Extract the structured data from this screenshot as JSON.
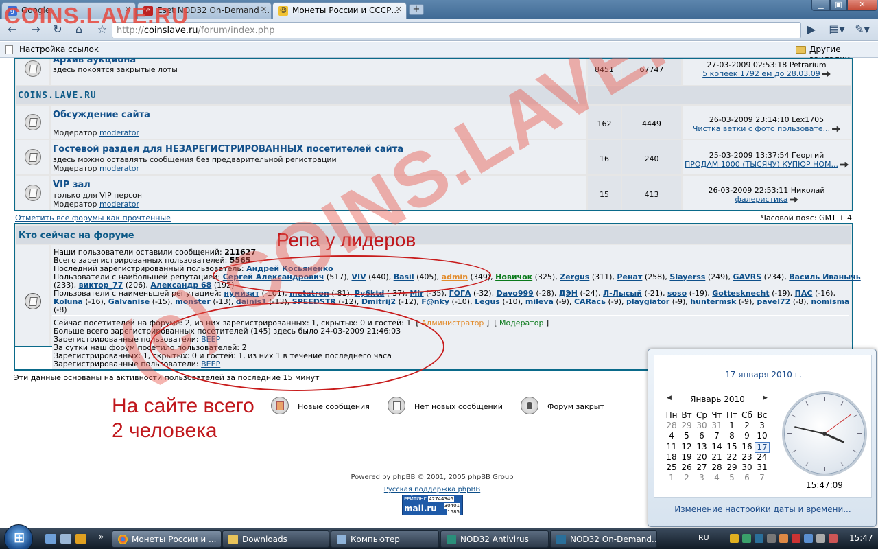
{
  "browser": {
    "tabs": [
      {
        "label": "Google"
      },
      {
        "label": "Eset NOD32 On-Demand ..."
      },
      {
        "label": "Монеты России и СССР..."
      }
    ],
    "url_prefix": "http://",
    "url_domain": "coinslave.ru",
    "url_path": "/forum/index.php",
    "bookmark_left": "Настройка ссылок",
    "bookmark_right": "Другие закладки"
  },
  "watermark_top": "COINS.LAVE.RU",
  "watermark_big": "(c) COINS.LAVE.RU",
  "forum": {
    "archive": {
      "title": "Архив аукциона",
      "desc": "здесь покоятся закрытые лоты",
      "topics": "8451",
      "posts": "67747",
      "last_date": "27-03-2009 02:53:18 Petrarium",
      "last_topic": "5 копеек 1792 ем до 28.03.09"
    },
    "category": "COINS.LAVE.RU",
    "rows": [
      {
        "title": "Обсуждение сайта",
        "desc": "",
        "mod_label": "Модератор",
        "mod": "moderator",
        "topics": "162",
        "posts": "4449",
        "last_date": "26-03-2009 23:14:10 Lex1705",
        "last_topic": "Чистка ветки с фото пользовате..."
      },
      {
        "title": "Гостевой раздел для НЕЗАРЕГИСТРИРОВАННЫХ посетителей сайта",
        "desc": "здесь можно оставлять сообщения без предварительной регистрации",
        "mod_label": "Модератор",
        "mod": "moderator",
        "topics": "16",
        "posts": "240",
        "last_date": "25-03-2009 13:37:54 Георгий",
        "last_topic": "ПРОДАМ 1000 (ТЫСЯЧУ) КУПЮР НОМ..."
      },
      {
        "title": "VIP зал",
        "desc": "только для VIP персон",
        "mod_label": "Модератор",
        "mod": "moderator",
        "topics": "15",
        "posts": "413",
        "last_date": "26-03-2009 22:53:11 Николай",
        "last_topic": "фалеристика"
      }
    ],
    "mark_read": "Отметить все форумы как прочтённые",
    "timezone": "Часовой пояс: GMT + 4"
  },
  "whoisonline": {
    "header": "Кто сейчас на форуме",
    "total_posts_label": "Наши пользователи оставили сообщений:",
    "total_posts": "211627",
    "total_users_label": "Всего зарегистрированных пользователей:",
    "total_users": "5565",
    "newest_label": "Последний зарегистрированный пользователь:",
    "newest": "Андрей Косьяненко",
    "best_label": "Пользователи с наибольшей репутацией:",
    "best_line1": [
      {
        "name": "Сергей Александрович",
        "val": "(517),"
      },
      {
        "name": "VIV",
        "val": "(440),"
      },
      {
        "name": "Basil",
        "val": "(405),"
      },
      {
        "name": "admin",
        "val": "(349),"
      },
      {
        "name": "Новичок",
        "val": "(325),"
      },
      {
        "name": "Zergus",
        "val": "(311),"
      },
      {
        "name": "Ренат",
        "val": "(258),"
      },
      {
        "name": "Slayerss",
        "val": "(249),"
      },
      {
        "name": "GAVRS",
        "val": "(234),"
      },
      {
        "name": "Василь Иванычь",
        "val": ""
      }
    ],
    "best_line2_lead": "(233),",
    "best_line2": [
      {
        "name": "виктор_77",
        "val": "(206),"
      },
      {
        "name": "Александр 68",
        "val": "(192)"
      }
    ],
    "worst_label": "Пользователи с наименьшей репутацией:",
    "worst_line1": [
      {
        "name": "нумизат",
        "val": "(-101),"
      },
      {
        "name": "metatron",
        "val": "(-81),"
      },
      {
        "name": "Py6ktd",
        "val": "(-37),"
      },
      {
        "name": "Mir",
        "val": "(-35),"
      },
      {
        "name": "ГОГА",
        "val": "(-32),"
      },
      {
        "name": "Davo999",
        "val": "(-28),"
      },
      {
        "name": "ДЭН",
        "val": "(-24),"
      },
      {
        "name": "Л-Лысый",
        "val": "(-21),"
      },
      {
        "name": "soso",
        "val": "(-19),"
      },
      {
        "name": "Gottesknecht",
        "val": "(-19),"
      },
      {
        "name": "ПАС",
        "val": "(-16),"
      }
    ],
    "worst_line2": [
      {
        "name": "Koluna",
        "val": "(-16),"
      },
      {
        "name": "Galvanise",
        "val": "(-15),"
      },
      {
        "name": "monster",
        "val": "(-13),"
      },
      {
        "name": "dainis1",
        "val": "(-13),"
      },
      {
        "name": "SPEEDSTR",
        "val": "(-12),"
      },
      {
        "name": "Dmitrij2",
        "val": "(-12),"
      },
      {
        "name": "F@nky",
        "val": "(-10),"
      },
      {
        "name": "Legus",
        "val": "(-10),"
      },
      {
        "name": "mileva",
        "val": "(-9),"
      },
      {
        "name": "CARась",
        "val": "(-9),"
      },
      {
        "name": "playgiator",
        "val": "(-9),"
      },
      {
        "name": "huntermsk",
        "val": "(-9),"
      },
      {
        "name": "pavel72",
        "val": "(-8),"
      },
      {
        "name": "nomisma",
        "val": ""
      }
    ],
    "worst_line3": "(-8)",
    "now_line": "Сейчас посетителей на форуме: 2, из них зарегистрированных: 1, скрытых: 0 и гостей: 1",
    "role_admin": "Администратор",
    "role_mod": "Модератор",
    "max_line": "Больше всего зарегистрированных посетителей (145) здесь было 24-03-2009 21:46:03",
    "reg_label": "Зарегистрированные пользователи:",
    "reg_user": "BEEP",
    "day_line": "За сутки наш форум посетило пользователей: 2",
    "hour_line": "Зарегистрированных: 1, скрытых: 0 и гостей: 1, из них 1 в течение последнего часа",
    "reg_label2": "Зарегистрированные пользователи:",
    "reg_user2": "BEEP",
    "footnote": "Эти данные основаны на активности пользователей за последние 15 минут"
  },
  "legend": {
    "new": "Новые сообщения",
    "old": "Нет новых сообщений",
    "closed": "Форум закрыт"
  },
  "annotations": {
    "leaders": "Репа у лидеров",
    "total_line1": "На сайте всего",
    "total_line2": "2 человека"
  },
  "footer": {
    "powered": "Powered by phpBB © 2001, 2005 phpBB Group",
    "support": "Русская поддержка phpBB",
    "rating_label": "РЕЙТИНГ",
    "rating_1": "42744346",
    "rating_2": "30401",
    "rating_3": "1585",
    "mail": "mail.ru"
  },
  "calendar": {
    "date": "17 января 2010 г.",
    "month": "Январь 2010",
    "weekdays": [
      "Пн",
      "Вт",
      "Ср",
      "Чт",
      "Пт",
      "Сб",
      "Вс"
    ],
    "weeks": [
      [
        "28",
        "29",
        "30",
        "31",
        "1",
        "2",
        "3"
      ],
      [
        "4",
        "5",
        "6",
        "7",
        "8",
        "9",
        "10"
      ],
      [
        "11",
        "12",
        "13",
        "14",
        "15",
        "16",
        "17"
      ],
      [
        "18",
        "19",
        "20",
        "21",
        "22",
        "23",
        "24"
      ],
      [
        "25",
        "26",
        "27",
        "28",
        "29",
        "30",
        "31"
      ],
      [
        "1",
        "2",
        "3",
        "4",
        "5",
        "6",
        "7"
      ]
    ],
    "today": "17",
    "time": "15:47:09",
    "change_link": "Изменение настройки даты и времени..."
  },
  "taskbar": {
    "items": [
      {
        "label": "Монеты России и ..."
      },
      {
        "label": "Downloads"
      },
      {
        "label": "Компьютер"
      },
      {
        "label": "NOD32 Antivirus"
      },
      {
        "label": "NOD32 On-Demand..."
      }
    ],
    "lang": "RU",
    "time": "15:47"
  }
}
